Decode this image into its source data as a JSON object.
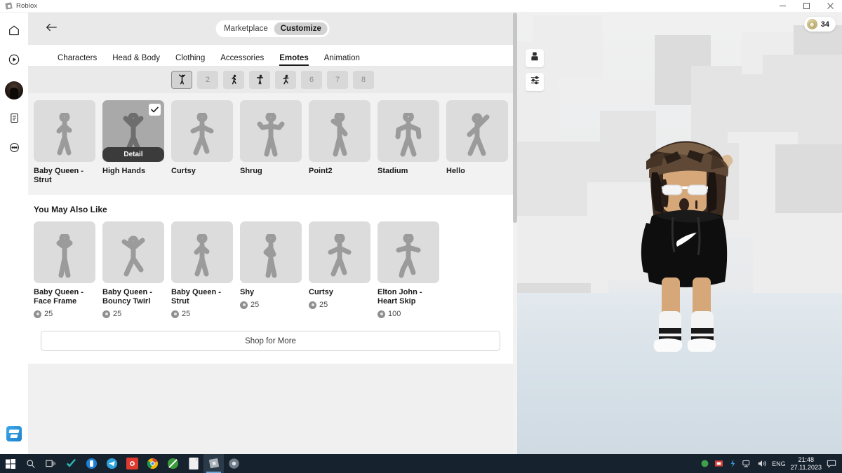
{
  "window": {
    "title": "Roblox",
    "controls": {
      "minimize": "minimize-icon",
      "maximize": "restore-icon",
      "close": "close-icon"
    }
  },
  "rail": {
    "items": [
      {
        "name": "home-icon",
        "label": "Home"
      },
      {
        "name": "play-circle-icon",
        "label": "Play"
      },
      {
        "name": "avatar-icon",
        "label": "Avatar",
        "active": true
      },
      {
        "name": "document-icon",
        "label": "Inventory"
      },
      {
        "name": "more-options-icon",
        "label": "More"
      }
    ],
    "bottom_item": {
      "name": "store-icon",
      "label": "Store"
    }
  },
  "header": {
    "back_icon": "back-arrow-icon",
    "segments": [
      {
        "label": "Marketplace",
        "active": false
      },
      {
        "label": "Customize",
        "active": true
      }
    ]
  },
  "tabs": [
    {
      "label": "Characters",
      "active": false
    },
    {
      "label": "Head & Body",
      "active": false
    },
    {
      "label": "Clothing",
      "active": false
    },
    {
      "label": "Accessories",
      "active": false
    },
    {
      "label": "Emotes",
      "active": true
    },
    {
      "label": "Animation",
      "active": false
    }
  ],
  "slots": [
    {
      "index": "1",
      "filled": true,
      "selected": true,
      "pose": "arms-up"
    },
    {
      "index": "2",
      "filled": false,
      "selected": false,
      "pose": ""
    },
    {
      "index": "3",
      "filled": true,
      "selected": false,
      "pose": "walk"
    },
    {
      "index": "4",
      "filled": true,
      "selected": false,
      "pose": "t-pose"
    },
    {
      "index": "5",
      "filled": true,
      "selected": false,
      "pose": "step"
    },
    {
      "index": "6",
      "filled": false,
      "selected": false,
      "pose": ""
    },
    {
      "index": "7",
      "filled": false,
      "selected": false,
      "pose": ""
    },
    {
      "index": "8",
      "filled": false,
      "selected": false,
      "pose": ""
    }
  ],
  "equipped": {
    "detail_label": "Detail",
    "items": [
      {
        "name": "Baby Queen - Strut",
        "selected": false,
        "pose": "strut"
      },
      {
        "name": "High Hands",
        "selected": true,
        "pose": "highhands"
      },
      {
        "name": "Curtsy",
        "selected": false,
        "pose": "curtsy"
      },
      {
        "name": "Shrug",
        "selected": false,
        "pose": "shrug"
      },
      {
        "name": "Point2",
        "selected": false,
        "pose": "point"
      },
      {
        "name": "Stadium",
        "selected": false,
        "pose": "stadium"
      },
      {
        "name": "Hello",
        "selected": false,
        "pose": "hello"
      }
    ]
  },
  "recommended": {
    "title": "You May Also Like",
    "items": [
      {
        "name": "Baby Queen - Face Frame",
        "price": "25",
        "pose": "faceframe"
      },
      {
        "name": "Baby Queen - Bouncy Twirl",
        "price": "25",
        "pose": "twirl"
      },
      {
        "name": "Baby Queen - Strut",
        "price": "25",
        "pose": "strut"
      },
      {
        "name": "Shy",
        "price": "25",
        "pose": "shy"
      },
      {
        "name": "Curtsy",
        "price": "25",
        "pose": "curtsy"
      },
      {
        "name": "Elton John - Heart Skip",
        "price": "100",
        "pose": "heartskip"
      }
    ]
  },
  "shop_button": {
    "label": "Shop for More"
  },
  "viewport": {
    "robux": {
      "amount": "34",
      "icon": "robux-coin-icon"
    },
    "tools": [
      {
        "name": "avatar-camera-icon"
      },
      {
        "name": "sliders-settings-icon"
      }
    ]
  },
  "taskbar": {
    "items": [
      {
        "name": "start-button"
      },
      {
        "name": "search-icon"
      },
      {
        "name": "task-view-icon"
      },
      {
        "name": "app-teal-icon"
      },
      {
        "name": "app-blue-icon"
      },
      {
        "name": "telegram-icon"
      },
      {
        "name": "app-red-icon"
      },
      {
        "name": "chrome-icon"
      },
      {
        "name": "app-green-icon"
      },
      {
        "name": "notepad-icon"
      },
      {
        "name": "roblox-icon",
        "active": true
      },
      {
        "name": "app-gray-icon"
      }
    ],
    "tray": {
      "language": "ENG",
      "time": "21:48",
      "date": "27.11.2023"
    }
  },
  "colors": {
    "panel_bg": "#f2f2f2",
    "header_bg": "#e9e9e9",
    "card_bg": "#dcdcdc",
    "card_selected_bg": "#a9a9a9",
    "accent_dark": "#1b1b1b",
    "taskbar_bg": "#16222e",
    "robux_gold": "#cbbd85"
  }
}
